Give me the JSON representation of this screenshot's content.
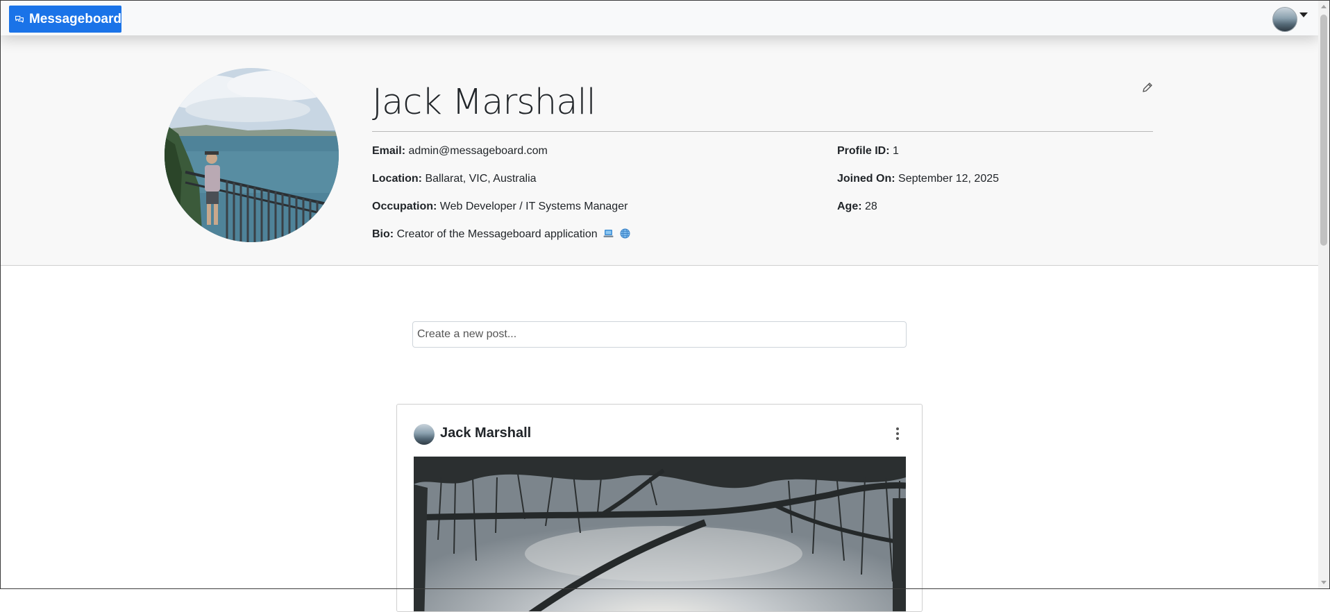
{
  "navbar": {
    "brand_label": "Messageboard",
    "brand_color": "#1a73e8"
  },
  "profile": {
    "name": "Jack Marshall",
    "email_label": "Email:",
    "email": "admin@messageboard.com",
    "location_label": "Location:",
    "location": "Ballarat, VIC, Australia",
    "occupation_label": "Occupation:",
    "occupation": "Web Developer / IT Systems Manager",
    "bio_label": "Bio:",
    "bio": "Creator of the Messageboard application",
    "bio_icons": [
      "laptop-emoji",
      "globe-emoji"
    ],
    "profile_id_label": "Profile ID:",
    "profile_id": "1",
    "joined_label": "Joined On:",
    "joined": "September 12, 2025",
    "age_label": "Age:",
    "age": "28"
  },
  "composer": {
    "placeholder": "Create a new post..."
  },
  "posts": [
    {
      "author": "Jack Marshall"
    }
  ]
}
